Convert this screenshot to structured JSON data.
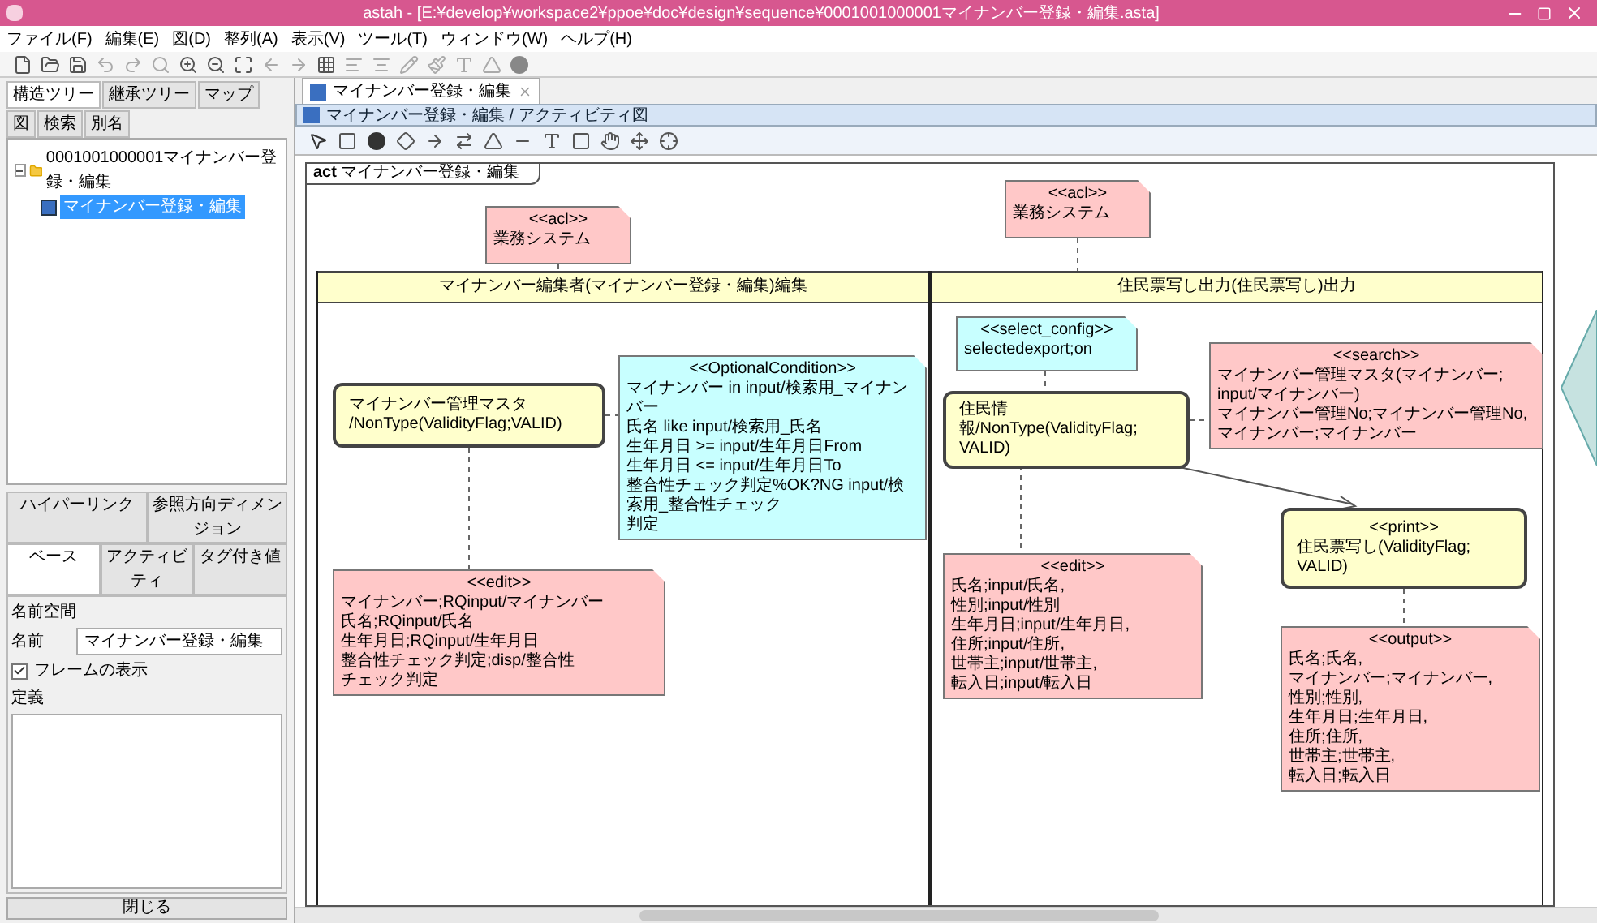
{
  "window": {
    "title": "astah - [E:¥develop¥workspace2¥ppoe¥doc¥design¥sequence¥0001001000001マイナンバー登録・編集.asta]"
  },
  "menu": [
    "ファイル(F)",
    "編集(E)",
    "図(D)",
    "整列(A)",
    "表示(V)",
    "ツール(T)",
    "ウィンドウ(W)",
    "ヘルプ(H)"
  ],
  "left_panel": {
    "tabs": [
      {
        "label": "構造ツリー",
        "selected": true
      },
      {
        "label": "継承ツリー",
        "selected": false
      },
      {
        "label": "マップ",
        "selected": false
      },
      {
        "label": "図",
        "selected": false
      },
      {
        "label": "検索",
        "selected": false
      },
      {
        "label": "別名",
        "selected": false
      }
    ],
    "tree": [
      {
        "label": "0001001000001マイナンバー登録・編集",
        "selected": false,
        "expanded": true,
        "children": [
          {
            "label": "マイナンバー登録・編集",
            "selected": true
          }
        ]
      }
    ]
  },
  "properties": {
    "tabs_row_1": [
      {
        "label": "ハイパーリンク",
        "selected": false
      },
      {
        "label": "参照方向ディメンジョン",
        "selected": false
      }
    ],
    "tabs_row_2": [
      {
        "label": "ベース",
        "selected": true
      },
      {
        "label": "アクティビティ",
        "selected": false
      },
      {
        "label": "タグ付き値",
        "selected": false
      }
    ],
    "namespace_label": "名前空間",
    "name_label": "名前",
    "name_value": "マイナンバー登録・編集",
    "frame_checkbox": {
      "label": "フレームの表示",
      "checked": true
    },
    "definition_label": "定義",
    "close_button": "閉じる"
  },
  "editor": {
    "tabs": [
      {
        "label": "マイナンバー登録・編集",
        "selected": true
      }
    ],
    "diagram_title": "マイナンバー登録・編集 / アクティビティ図"
  },
  "diagram": {
    "frame_label": "**act** マイナンバー登録・編集",
    "partitions": [
      {
        "title": "マイナンバー編集者(マイナンバー登録・編集)編集"
      },
      {
        "title": "住民票写し出力(住民票写し)出力"
      }
    ],
    "nodes": [
      {
        "kind": "note",
        "color": "#ffc8c8",
        "stereotype": "<<acl>>",
        "lines": [
          "業務システム"
        ]
      },
      {
        "kind": "note",
        "color": "#ffc8c8",
        "stereotype": "<<acl>>",
        "lines": [
          "業務システム"
        ]
      },
      {
        "kind": "action",
        "lines": [
          "マイナンバー管理マスタ",
          "/NonType(ValidityFlag;VALID)"
        ]
      },
      {
        "kind": "note",
        "color": "#c8ffff",
        "stereotype": "<<OptionalCondition>>",
        "lines": [
          "マイナンバー in input/検索用_マイナンバー",
          "氏名 like input/検索用_氏名",
          "生年月日 >= input/生年月日From",
          "生年月日 <= input/生年月日To",
          "整合性チェック判定%OK?NG input/検索用_整合性チェック",
          "判定"
        ]
      },
      {
        "kind": "note",
        "color": "#ffc8c8",
        "stereotype": "<<edit>>",
        "lines": [
          "マイナンバー;RQinput/マイナンバー",
          "氏名;RQinput/氏名",
          "生年月日;RQinput/生年月日",
          "整合性チェック判定;disp/整合性",
          "チェック判定"
        ]
      },
      {
        "kind": "note",
        "color": "#c8ffff",
        "stereotype": "<<select_config>>",
        "lines": [
          "selectedexport;on"
        ]
      },
      {
        "kind": "action",
        "lines": [
          "住民情報/NonType(ValidityFlag;",
          "VALID)"
        ]
      },
      {
        "kind": "note",
        "color": "#ffc8c8",
        "stereotype": "<<search>>",
        "lines": [
          "マイナンバー管理マスタ(マイナンバー;",
          "input/マイナンバー)",
          "マイナンバー管理No;マイナンバー管理No,",
          "マイナンバー;マイナンバー"
        ]
      },
      {
        "kind": "action",
        "stereotype": "<<print>>",
        "lines": [
          "住民票写し(ValidityFlag;",
          "VALID)"
        ]
      },
      {
        "kind": "note",
        "color": "#ffc8c8",
        "stereotype": "<<edit>>",
        "lines": [
          "氏名;input/氏名,",
          "性別;input/性別",
          "生年月日;input/生年月日,",
          "住所;input/住所,",
          "世帯主;input/世帯主,",
          "転入日;input/転入日"
        ]
      },
      {
        "kind": "note",
        "color": "#ffc8c8",
        "stereotype": "<<output>>",
        "lines": [
          "氏名;氏名,",
          "マイナンバー;マイナンバー,",
          "性別;性別,",
          "生年月日;生年月日,",
          "住所;住所,",
          "世帯主;世帯主,",
          "転入日;転入日"
        ]
      }
    ]
  }
}
